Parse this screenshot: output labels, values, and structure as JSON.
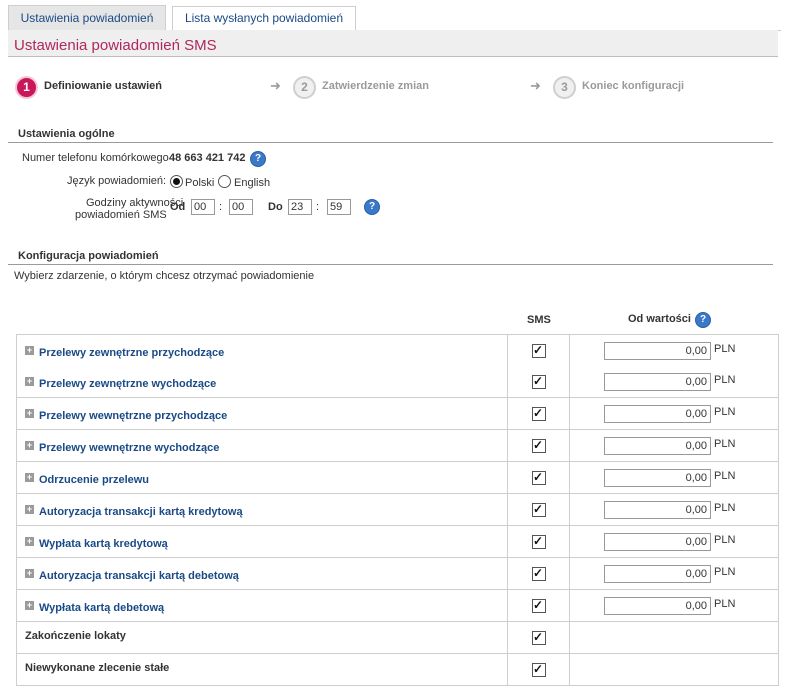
{
  "tabs": [
    {
      "label": "Ustawienia powiadomień",
      "active": true
    },
    {
      "label": "Lista wysłanych powiadomień",
      "active": false
    }
  ],
  "header": {
    "title": "Ustawienia powiadomień SMS"
  },
  "steps": [
    {
      "number": "1",
      "label": "Definiowanie ustawień",
      "active": true
    },
    {
      "number": "2",
      "label": "Zatwierdzenie zmian",
      "active": false
    },
    {
      "number": "3",
      "label": "Koniec konfiguracji",
      "active": false
    }
  ],
  "general": {
    "title": "Ustawienia ogólne",
    "phone_label": "Numer telefonu komórkowego",
    "phone_value": "48 663 421 742",
    "language_label": "Język powiadomień:",
    "language_options": [
      {
        "label": "Polski",
        "selected": true
      },
      {
        "label": "English",
        "selected": false
      }
    ],
    "hours_label_line1": "Godziny aktywności",
    "hours_label_line2": "powiadomień SMS",
    "from_label": "Od",
    "to_label": "Do",
    "from_hour": "00",
    "from_minute": "00",
    "to_hour": "23",
    "to_minute": "59",
    "colon": ":"
  },
  "config": {
    "title": "Konfiguracja powiadomień",
    "subtitle": "Wybierz zdarzenie, o którym chcesz otrzymać powiadomienie",
    "col_sms": "SMS",
    "col_from_value": "Od wartości",
    "currency": "PLN",
    "help_icon": "question-mark",
    "rows": [
      {
        "label": "Przelewy zewnętrzne przychodzące",
        "sms": true,
        "amount": "0,00",
        "expandable": true
      },
      {
        "label": "Przelewy zewnętrzne wychodzące",
        "sms": true,
        "amount": "0,00",
        "expandable": true
      },
      {
        "label": "Przelewy wewnętrzne przychodzące",
        "sms": true,
        "amount": "0,00",
        "expandable": true
      },
      {
        "label": "Przelewy wewnętrzne wychodzące",
        "sms": true,
        "amount": "0,00",
        "expandable": true
      },
      {
        "label": "Odrzucenie przelewu",
        "sms": true,
        "amount": "0,00",
        "expandable": true
      },
      {
        "label": "Autoryzacja transakcji kartą kredytową",
        "sms": true,
        "amount": "0,00",
        "expandable": true
      },
      {
        "label": "Wypłata kartą kredytową",
        "sms": true,
        "amount": "0,00",
        "expandable": true
      },
      {
        "label": "Autoryzacja transakcji kartą debetową",
        "sms": true,
        "amount": "0,00",
        "expandable": true
      },
      {
        "label": "Wypłata kartą debetową",
        "sms": true,
        "amount": "0,00",
        "expandable": true
      },
      {
        "label": "Zakończenie lokaty",
        "sms": true,
        "amount": null,
        "expandable": false
      },
      {
        "label": "Niewykonane zlecenie stałe",
        "sms": true,
        "amount": null,
        "expandable": false
      }
    ]
  },
  "colors": {
    "accent": "#c8185a",
    "link": "#1a4a86",
    "help": "#3a78c8"
  }
}
